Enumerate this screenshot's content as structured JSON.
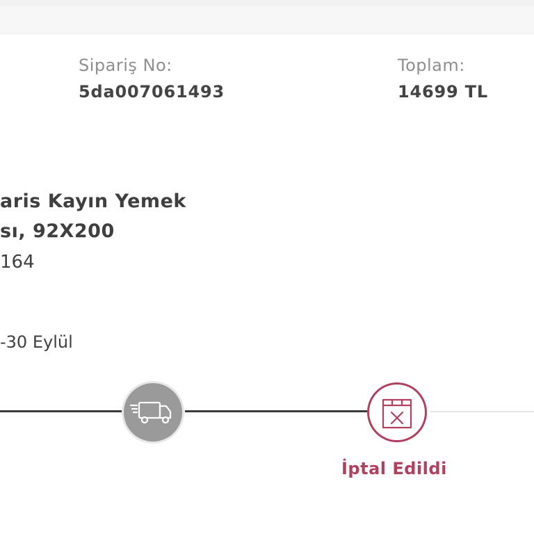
{
  "order": {
    "number_label": "Sipariş No:",
    "number_value": "5da007061493",
    "total_label": "Toplam:",
    "total_value": "14699 TL"
  },
  "product": {
    "name_line1": "aris Kayın Yemek",
    "name_line2": "sı, 92X200",
    "code": "164",
    "delivery": "-30 Eylül"
  },
  "tracking": {
    "steps": [
      {
        "icon": "truck-icon",
        "state": "passed"
      },
      {
        "icon": "cancelled-box-icon",
        "state": "active",
        "label": "İptal Edildi"
      }
    ]
  },
  "colors": {
    "accent": "#b0405e",
    "text": "#444444",
    "muted": "#8f8f8f",
    "step_grey": "#9a9a9a"
  }
}
